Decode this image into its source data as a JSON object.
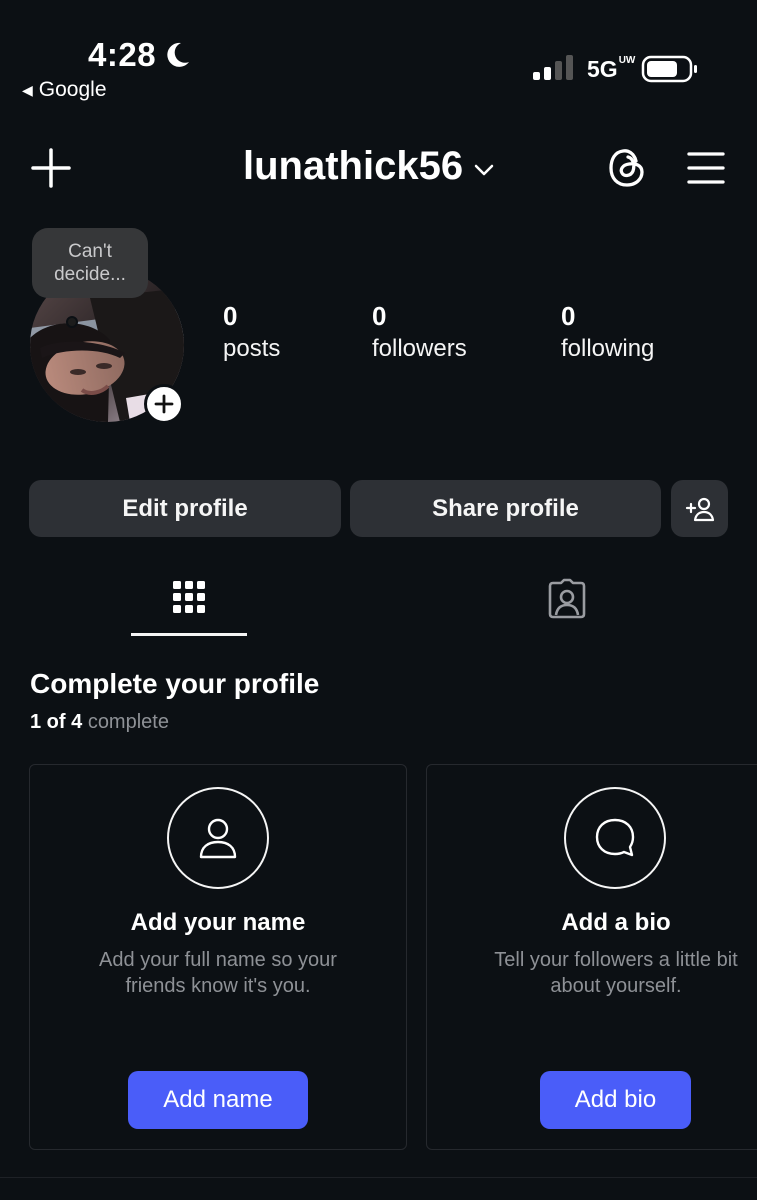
{
  "status_bar": {
    "time": "4:28",
    "back_app": "Google",
    "network": "5G",
    "network_sup": "UW",
    "icons": [
      "moon-icon",
      "signal-icon",
      "battery-icon"
    ]
  },
  "header": {
    "username": "lunathick56",
    "icons": [
      "plus-icon",
      "chevron-down-icon",
      "threads-icon",
      "menu-icon"
    ]
  },
  "profile": {
    "note_text": "Can't decide...",
    "stats": [
      {
        "value": "0",
        "label": "posts"
      },
      {
        "value": "0",
        "label": "followers"
      },
      {
        "value": "0",
        "label": "following"
      }
    ]
  },
  "actions": {
    "edit_label": "Edit profile",
    "share_label": "Share profile"
  },
  "tabs": [
    {
      "name": "grid",
      "active": true
    },
    {
      "name": "tagged",
      "active": false
    }
  ],
  "complete_profile": {
    "title": "Complete your profile",
    "progress_count": "1 of 4",
    "progress_word": "complete",
    "cards": [
      {
        "title": "Add your name",
        "desc_line1": "Add your full name so your",
        "desc_line2": "friends know it's you.",
        "button": "Add name",
        "icon": "person-icon"
      },
      {
        "title": "Add a bio",
        "desc_line1": "Tell your followers a little bit",
        "desc_line2": "about yourself.",
        "button": "Add bio",
        "icon": "speech-bubble-icon"
      }
    ]
  },
  "colors": {
    "background": "#0c1014",
    "button_gray": "#2d3035",
    "accent_blue": "#4a5df9",
    "muted_text": "#8e9196"
  }
}
